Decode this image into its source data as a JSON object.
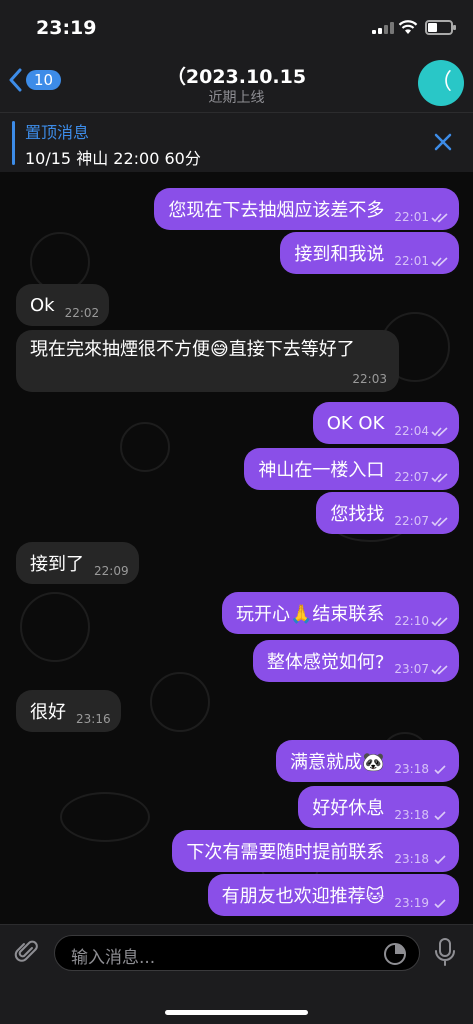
{
  "status": {
    "time": "23:19"
  },
  "header": {
    "back_count": "10",
    "title": "（2023.10.15",
    "subtitle": "近期上线",
    "avatar_letter": "（"
  },
  "pinned": {
    "title": "置顶消息",
    "text": "10/15 神山 22:00 60分"
  },
  "messages": [
    {
      "dir": "out",
      "text": "您现在下去抽烟应该差不多",
      "time": "22:01",
      "read": true
    },
    {
      "dir": "out",
      "text": "接到和我说",
      "time": "22:01",
      "read": true
    },
    {
      "dir": "in",
      "text": "Ok",
      "time": "22:02"
    },
    {
      "dir": "in",
      "text": "現在完來抽煙很不方便😅直接下去等好了",
      "time": "22:03"
    },
    {
      "dir": "out",
      "text": "OK OK",
      "time": "22:04",
      "read": true
    },
    {
      "dir": "out",
      "text": "神山在一楼入口",
      "time": "22:07",
      "read": true
    },
    {
      "dir": "out",
      "text": "您找找",
      "time": "22:07",
      "read": true
    },
    {
      "dir": "in",
      "text": "接到了",
      "time": "22:09"
    },
    {
      "dir": "out",
      "text": "玩开心🙏结束联系",
      "time": "22:10",
      "read": true
    },
    {
      "dir": "out",
      "text": "整体感觉如何?",
      "time": "23:07",
      "read": true
    },
    {
      "dir": "in",
      "text": "很好",
      "time": "23:16"
    },
    {
      "dir": "out",
      "text": "满意就成🐼",
      "time": "23:18",
      "read": false
    },
    {
      "dir": "out",
      "text": "好好休息",
      "time": "23:18",
      "read": false
    },
    {
      "dir": "out",
      "text": "下次有需要随时提前联系",
      "time": "23:18",
      "read": false
    },
    {
      "dir": "out",
      "text": "有朋友也欢迎推荐🐱",
      "time": "23:19",
      "read": false
    }
  ],
  "input": {
    "placeholder": "输入消息..."
  },
  "colors": {
    "outgoing": "#8a4fe8",
    "incoming": "#262626",
    "accent": "#3d8ce8",
    "avatar": "#29c7c7"
  }
}
